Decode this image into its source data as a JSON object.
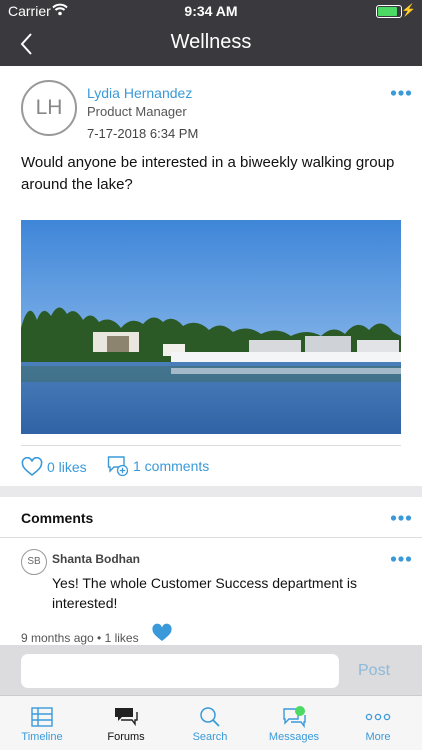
{
  "status_bar": {
    "carrier": "Carrier",
    "time": "9:34 AM"
  },
  "nav": {
    "title": "Wellness",
    "back_icon": "chevron-left-icon"
  },
  "post": {
    "avatar_initials": "LH",
    "author": "Lydia Hernandez",
    "role": "Product Manager",
    "timestamp": "7-17-2018 6:34 PM",
    "text": "Would anyone be interested in a biweekly walking group around the lake?",
    "likes_label": "0 likes",
    "comments_label": "1 comments"
  },
  "comments": {
    "title": "Comments",
    "items": [
      {
        "avatar_initials": "SB",
        "author": "Shanta Bodhan",
        "text": "Yes! The whole Customer Success department is interested!",
        "meta": "9 months ago • 1 likes"
      }
    ]
  },
  "compose": {
    "placeholder": "",
    "post_label": "Post"
  },
  "tabbar": {
    "tabs": [
      {
        "label": "Timeline",
        "icon": "timeline-icon"
      },
      {
        "label": "Forums",
        "icon": "forums-icon",
        "active": true
      },
      {
        "label": "Search",
        "icon": "search-icon"
      },
      {
        "label": "Messages",
        "icon": "messages-icon"
      },
      {
        "label": "More",
        "icon": "more-icon"
      }
    ]
  },
  "colors": {
    "accent": "#3a9ad9",
    "bar": "#3a3a3e",
    "online": "#4cd964"
  }
}
